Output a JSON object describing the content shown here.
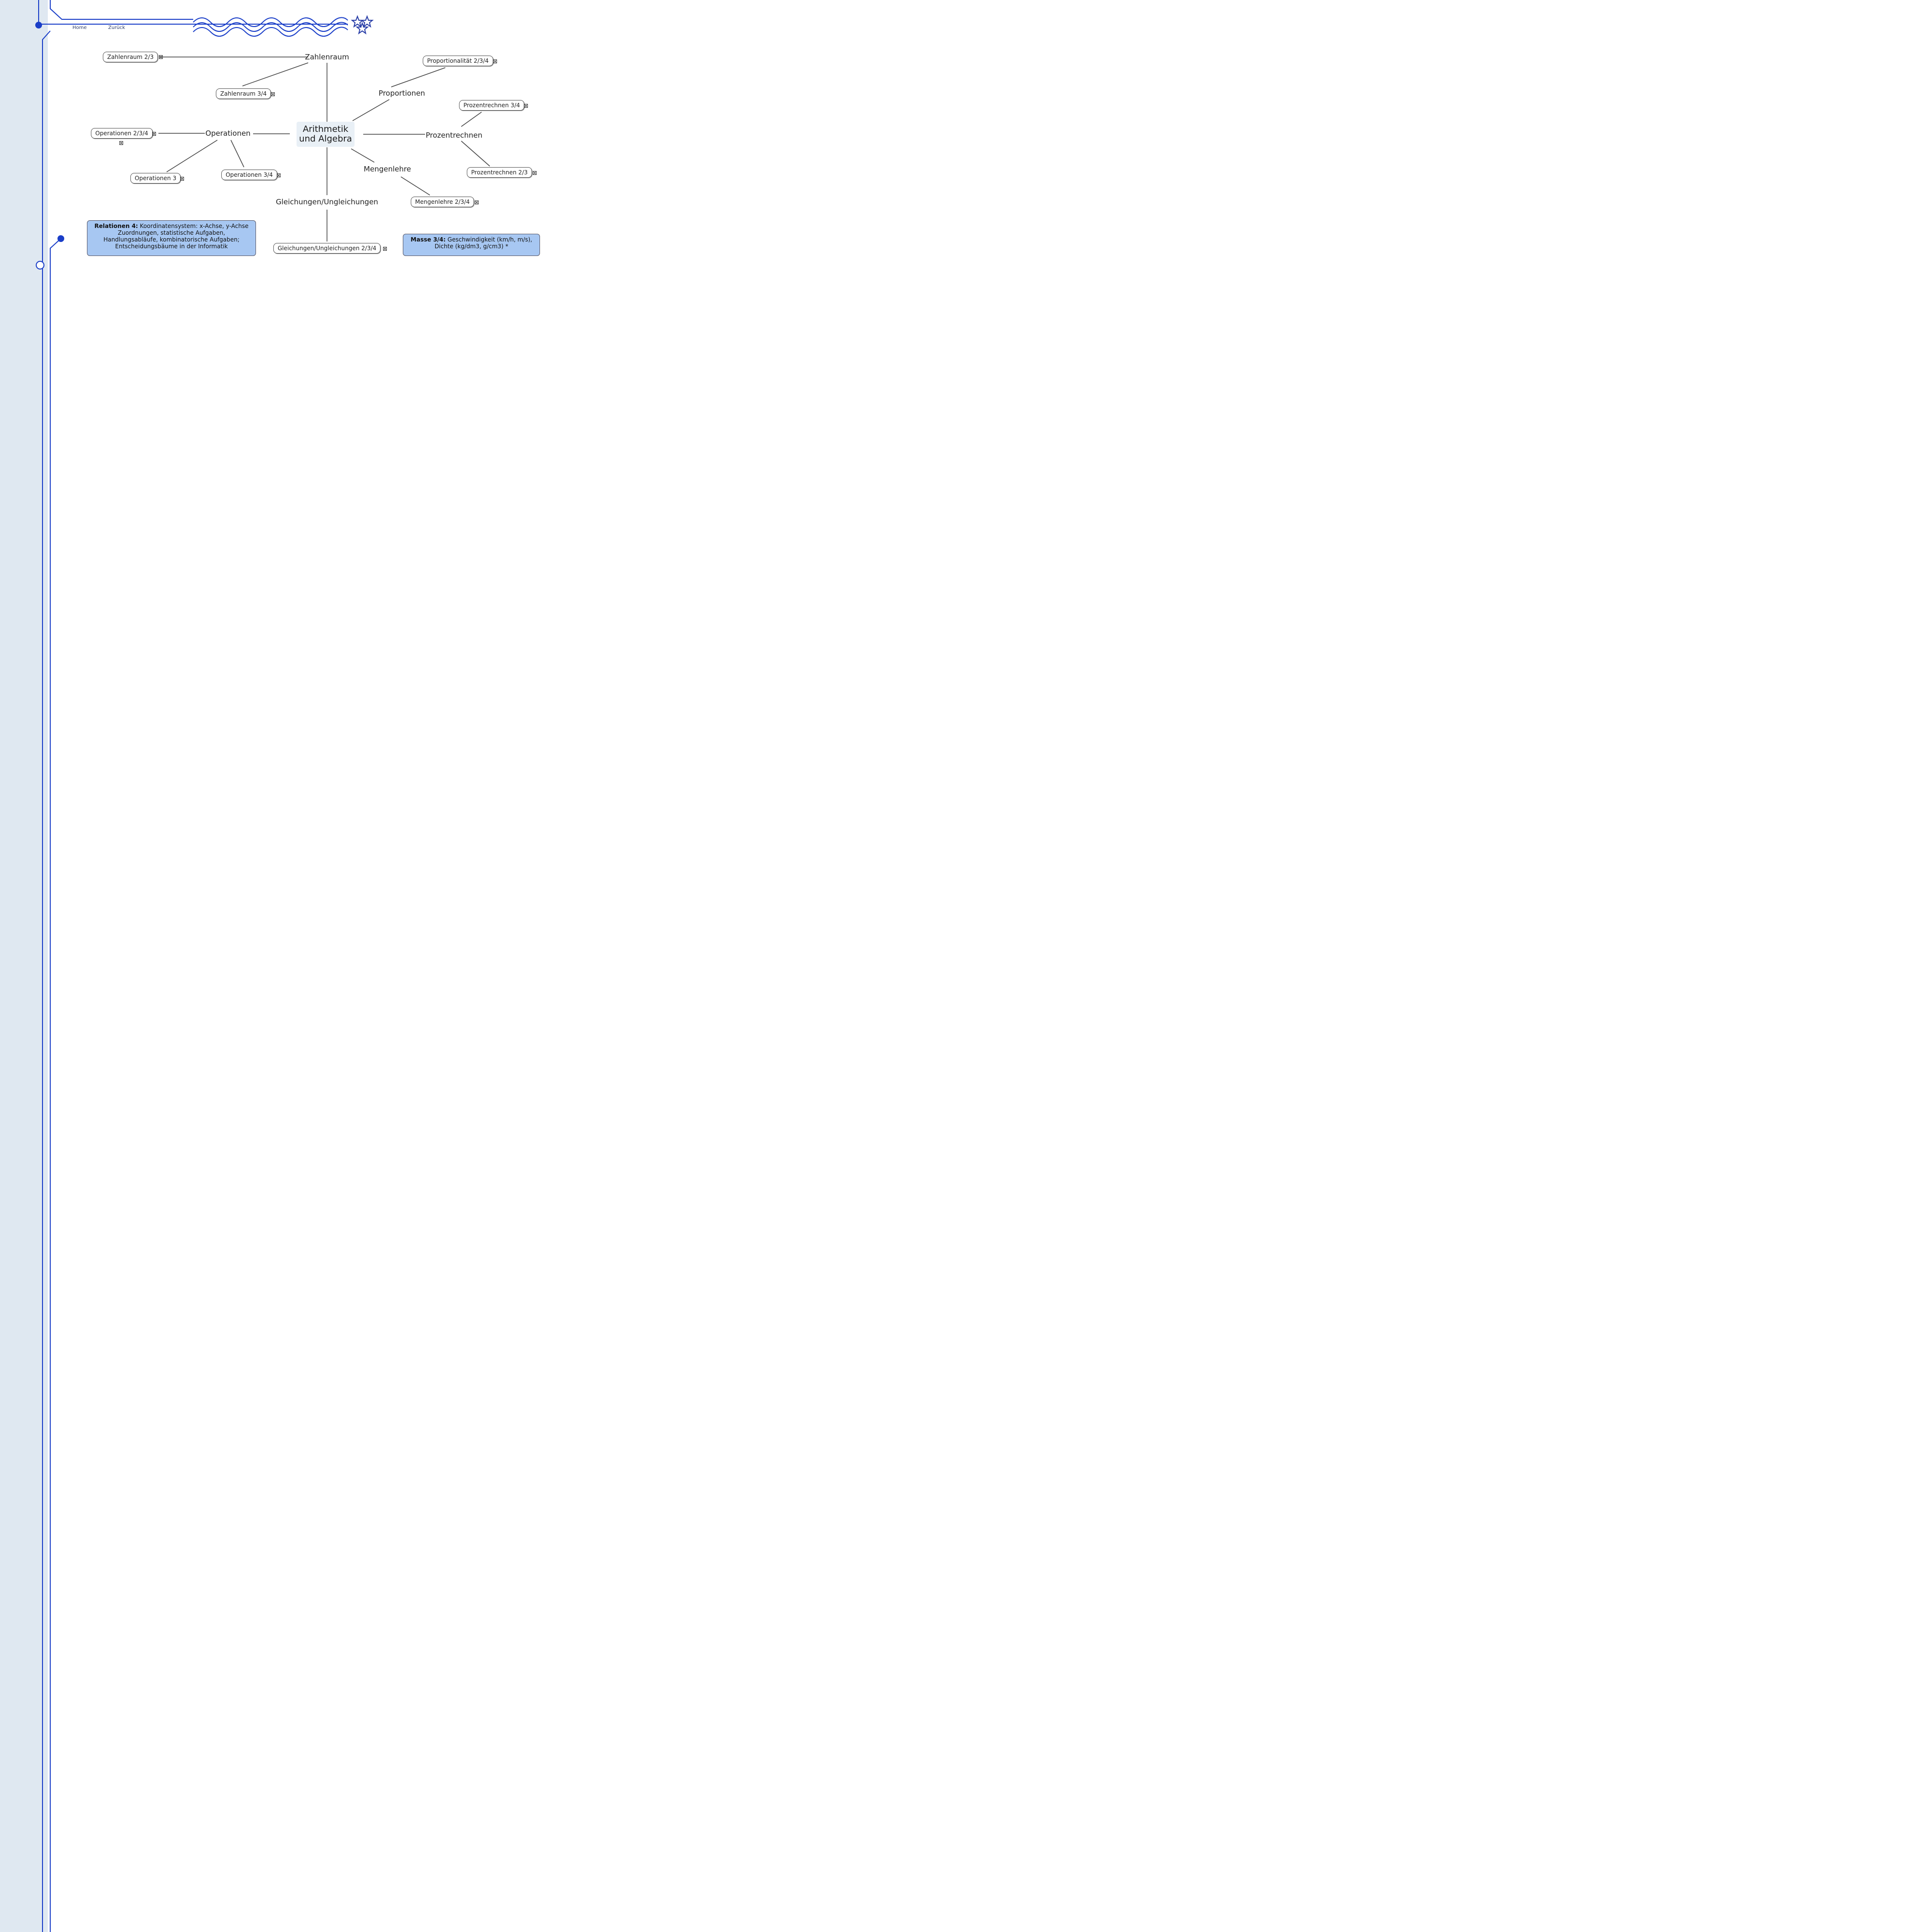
{
  "nav": {
    "home": "Home",
    "back": "Zurück"
  },
  "icons": {
    "star": "star-icon",
    "attachment": "attachment-icon"
  },
  "colors": {
    "wire": "#1a3ec8",
    "sidebar": "#dfe8f1",
    "note": "#a7c7f2"
  },
  "mindmap": {
    "root": "Arithmetik und Algebra",
    "topics": {
      "zahlenraum": "Zahlenraum",
      "proportionen": "Proportionen",
      "operationen": "Operationen",
      "prozentrechnen": "Prozentrechnen",
      "mengenlehre": "Mengenlehre",
      "gleichungen": "Gleichungen/Ungleichungen"
    },
    "leaves": {
      "zahlenraum_23": "Zahlenraum 2/3",
      "zahlenraum_34": "Zahlenraum 3/4",
      "proportionalitaet_234": "Proportionalität 2/3/4",
      "prozentrechnen_34": "Prozentrechnen 3/4",
      "prozentrechnen_23": "Prozentrechnen 2/3",
      "operationen_234": "Operationen 2/3/4",
      "operationen_3": "Operationen 3",
      "operationen_34": "Operationen 3/4",
      "mengenlehre_234": "Mengenlehre 2/3/4",
      "gleichungen_234": "Gleichungen/Ungleichungen 2/3/4"
    },
    "notes": {
      "relationen": {
        "title": "Relationen 4:",
        "text": "Koordinatensystem: x-Achse, y-Achse Zuordnungen, statistische Aufgaben, Handlungsabläufe, kombinatorische Aufgaben; Entscheidungsbäume in der Informatik"
      },
      "masse": {
        "title": "Masse 3/4:",
        "text": "Geschwindigkeit (km/h, m/s), Dichte (kg/dm3, g/cm3) *"
      }
    }
  }
}
